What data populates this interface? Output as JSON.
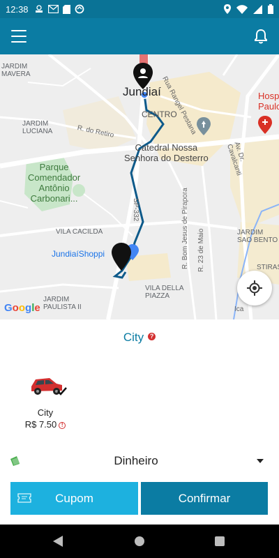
{
  "status_bar": {
    "time": "12:38",
    "left_icons": [
      "brand-icon",
      "gmail-icon",
      "sd-card-icon",
      "sync-icon"
    ],
    "right_icons": [
      "location-icon",
      "wifi-icon",
      "signal-icon",
      "battery-icon"
    ]
  },
  "app_bar": {
    "menu_icon": "hamburger-icon",
    "notification_icon": "bell-icon",
    "color": "#0b7ca3"
  },
  "map": {
    "city_label": "Jundiaí",
    "district_label": "CENTRO",
    "labels": {
      "jardim_mavera": "JARDIM\nMAVERA",
      "jardim_luciana": "JARDIM\nLUCIANA",
      "rua_rangel": "Rua Rangel Pestana",
      "r_retiro": "R. do Retiro",
      "catedral": "Catedral Nossa\nSenhora do Desterro",
      "parque": "Parque\nComendador\nAntônio\nCarbonari...",
      "hospital": "Hosp\nPaulo",
      "av_cavalcanti": "Av. Dr. Cavalcanti",
      "sp_332": "SP-332",
      "vila_cacilda": "VILA CACILDA",
      "shopping": "JundiaíShoppi",
      "r_bom_jesus": "R. Bom Jesus de Pirapora",
      "r_23_maio": "R. 23 de Maio",
      "jardim_sao_bento": "JARDIM\nSAO BENTO",
      "vila_della_piazza": "VILA DELLA\nPIAZZA",
      "jardim_paulista": "JARDIM\nPAULISTA II",
      "ica": "Ica",
      "stiras": "STIRAS"
    },
    "google_letters": [
      "G",
      "o",
      "o",
      "g",
      "l",
      "e"
    ],
    "google_colors": [
      "#4285f4",
      "#ea4335",
      "#fbbc05",
      "#4285f4",
      "#34a853",
      "#ea4335"
    ],
    "route_color": "#0e5a8a",
    "locate_icon": "my-location-icon"
  },
  "service": {
    "title": "City",
    "help_icon": "help-icon"
  },
  "vehicle": {
    "name": "City",
    "price": "R$ 7.50",
    "selected_icon": "checkmark-icon",
    "car_color": "#d32f2f"
  },
  "payment": {
    "icon": "money-icon",
    "method": "Dinheiro"
  },
  "buttons": {
    "coupon": "Cupom",
    "confirm": "Confirmar"
  },
  "nav_bar": {
    "back_icon": "back-icon",
    "home_icon": "home-icon",
    "recent_icon": "recent-apps-icon"
  }
}
